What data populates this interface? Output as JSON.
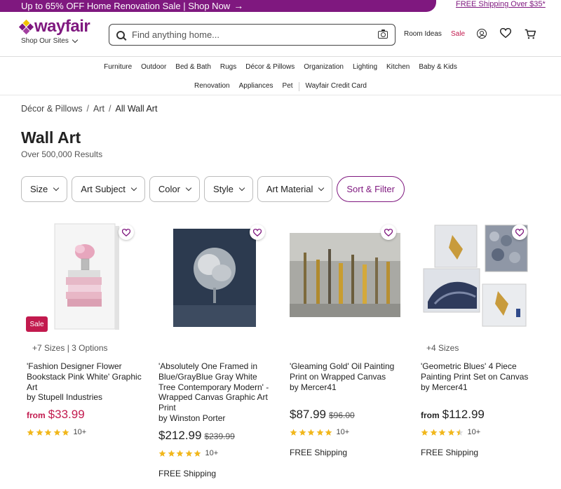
{
  "promo": {
    "text": "Up to 65% OFF Home Renovation Sale | Shop Now",
    "free_shipping": "FREE Shipping Over $35*"
  },
  "header": {
    "logo": "wayfair",
    "shop_sites": "Shop Our Sites",
    "search_placeholder": "Find anything home...",
    "room_ideas": "Room Ideas",
    "sale": "Sale"
  },
  "nav": {
    "row1": [
      "Furniture",
      "Outdoor",
      "Bed & Bath",
      "Rugs",
      "Décor & Pillows",
      "Organization",
      "Lighting",
      "Kitchen",
      "Baby & Kids"
    ],
    "row2": [
      "Renovation",
      "Appliances",
      "Pet"
    ],
    "credit_card": "Wayfair Credit Card"
  },
  "breadcrumb": [
    "Décor & Pillows",
    "Art",
    "All Wall Art"
  ],
  "page": {
    "title": "Wall Art",
    "results": "Over 500,000 Results"
  },
  "filters": [
    "Size",
    "Art Subject",
    "Color",
    "Style",
    "Art Material"
  ],
  "sort_filter": "Sort & Filter",
  "products": [
    {
      "options": "+7 Sizes | 3 Options",
      "title": "'Fashion Designer Flower Bookstack Pink White' Graphic Art",
      "brand": "by Stupell Industries",
      "from": "from",
      "price": "$33.99",
      "was": "",
      "rating": 5,
      "reviews": "10+",
      "shipping": "",
      "badge": "Sale"
    },
    {
      "options": "",
      "title": "'Absolutely One Framed in Blue/GrayBlue Gray White Tree Contemporary Modern' - Wrapped Canvas Graphic Art Print",
      "brand": "by Winston Porter",
      "from": "",
      "price": "$212.99",
      "was": "$239.99",
      "rating": 5,
      "reviews": "10+",
      "shipping": "FREE Shipping"
    },
    {
      "options": "",
      "title": "'Gleaming Gold' Oil Painting Print on Wrapped Canvas",
      "brand": "by Mercer41",
      "from": "",
      "price": "$87.99",
      "was": "$96.00",
      "rating": 5,
      "reviews": "10+",
      "shipping": "FREE Shipping"
    },
    {
      "options": "+4 Sizes",
      "title": "'Geometric Blues' 4 Piece Painting Print Set on Canvas",
      "brand": "by Mercer41",
      "from": "from",
      "price": "$112.99",
      "was": "",
      "rating": 4.5,
      "reviews": "10+",
      "shipping": "FREE Shipping"
    }
  ],
  "colors": {
    "brand": "#7f187f",
    "sale": "#c21a4e",
    "star": "#f1b71c"
  }
}
